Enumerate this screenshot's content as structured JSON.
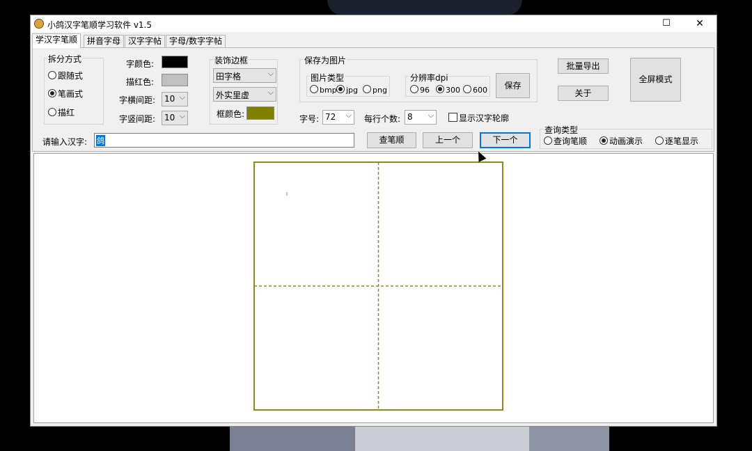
{
  "window": {
    "title": "小鸽汉字笔顺学习软件 v1.5"
  },
  "tabs": [
    "学汉字笔顺",
    "拼音字母",
    "汉字字帖",
    "字母/数字字帖"
  ],
  "split": {
    "title": "拆分方式",
    "options": [
      {
        "label": "跟随式",
        "selected": false
      },
      {
        "label": "笔画式",
        "selected": true
      },
      {
        "label": "描红",
        "selected": false
      }
    ]
  },
  "colors": {
    "font_color_label": "字颜色:",
    "trace_color_label": "描红色:",
    "h_spacing_label": "字横间距:",
    "v_spacing_label": "字竖间距:",
    "h_spacing_value": "10",
    "v_spacing_value": "10",
    "font_color": "#000000",
    "trace_color": "#c0c0c0"
  },
  "decor": {
    "title": "装饰边框",
    "grid_type": "田字格",
    "border_type": "外实里虚",
    "frame_color_label": "框颜色:",
    "frame_color": "#808000"
  },
  "save": {
    "title": "保存为图片",
    "type_title": "图片类型",
    "types": [
      {
        "label": "bmp",
        "selected": false
      },
      {
        "label": "jpg",
        "selected": true
      },
      {
        "label": "png",
        "selected": false
      }
    ],
    "dpi_title": "分辨率dpi",
    "dpis": [
      {
        "label": "96",
        "selected": false
      },
      {
        "label": "300",
        "selected": true
      },
      {
        "label": "600",
        "selected": false
      }
    ],
    "save_button": "保存"
  },
  "buttons": {
    "batch_export": "批量导出",
    "about": "关于",
    "fullscreen": "全屏模式",
    "check_strokes": "查笔顺",
    "prev": "上一个",
    "next": "下一个"
  },
  "size": {
    "label": "字号:",
    "value": "72"
  },
  "per_row": {
    "label": "每行个数:",
    "value": "8"
  },
  "outline": {
    "label": "显示汉字轮廓",
    "checked": false
  },
  "input": {
    "label": "请输入汉字:",
    "value": "鸽"
  },
  "query": {
    "title": "查询类型",
    "options": [
      {
        "label": "查询笔顺",
        "selected": false
      },
      {
        "label": "动画演示",
        "selected": true
      },
      {
        "label": "逐笔显示",
        "selected": false
      }
    ]
  },
  "grid": {
    "frame_color": "#8b8b1e"
  }
}
